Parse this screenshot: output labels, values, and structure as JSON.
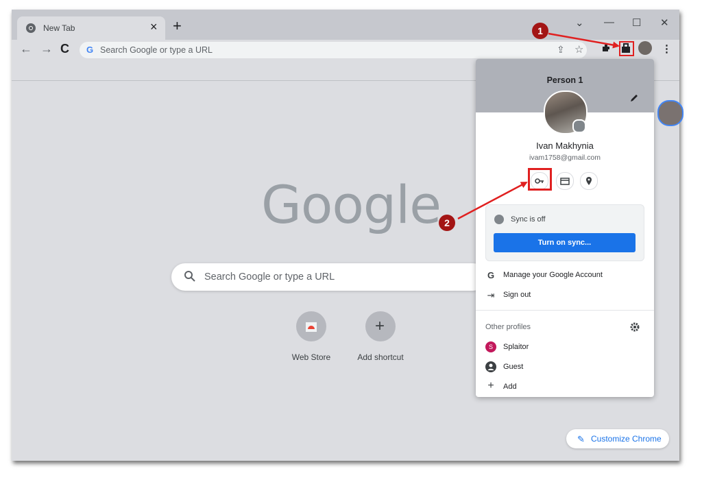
{
  "tab": {
    "title": "New Tab"
  },
  "toolbar": {
    "omnibox_placeholder": "Search Google or type a URL"
  },
  "ntp": {
    "logo": "Google",
    "search_placeholder": "Search Google or type a URL",
    "shortcuts": [
      {
        "label": "Web Store"
      },
      {
        "label": "Add shortcut"
      }
    ],
    "customize_label": "Customize Chrome"
  },
  "profile_menu": {
    "header": "Person 1",
    "name": "Ivan Makhynia",
    "email": "ivam1758@gmail.com",
    "sync_status": "Sync is off",
    "sync_button": "Turn on sync...",
    "manage_account": "Manage your Google Account",
    "sign_out": "Sign out",
    "other_profiles_label": "Other profiles",
    "profiles": [
      {
        "name": "Splaitor",
        "initial": "S"
      },
      {
        "name": "Guest"
      }
    ],
    "add_label": "Add"
  },
  "annotations": {
    "step1": "1",
    "step2": "2"
  },
  "colors": {
    "accent": "#1a73e8",
    "annotation_red": "#e02020",
    "step_badge": "#a31515"
  }
}
